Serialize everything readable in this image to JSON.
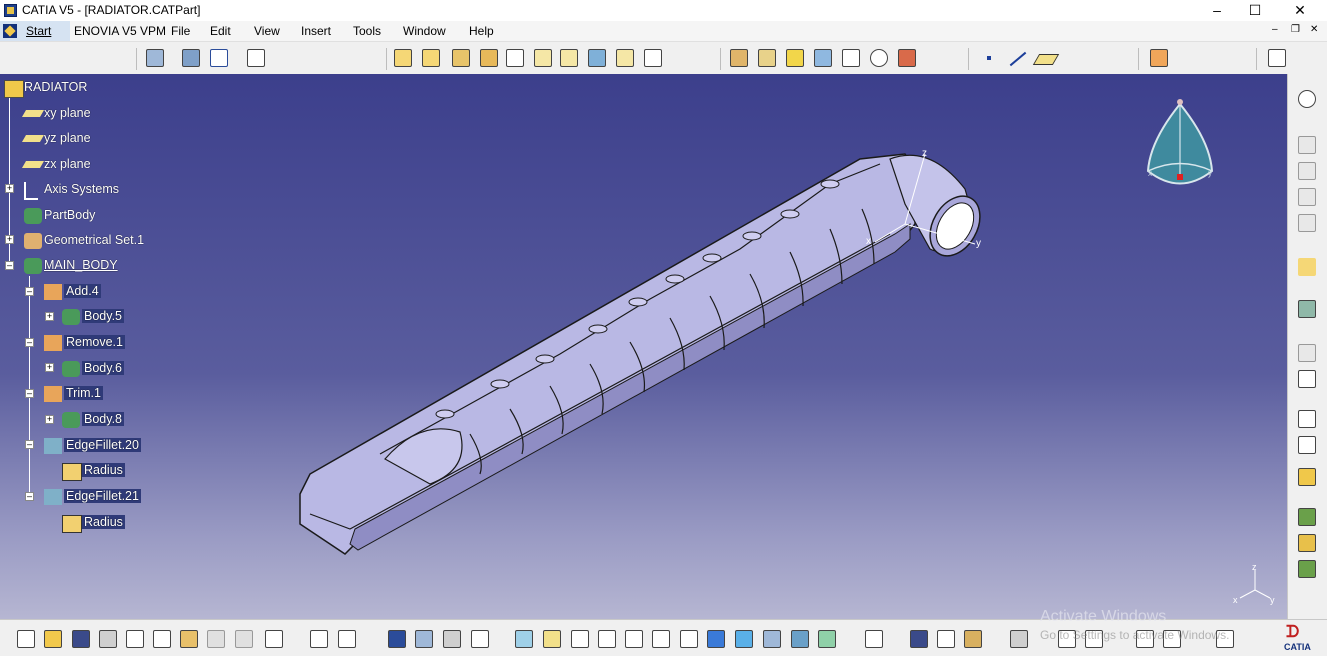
{
  "window": {
    "title": "CATIA V5 - [RADIATOR.CATPart]",
    "controls": [
      "–",
      "☐",
      "✕"
    ]
  },
  "menu": {
    "start": "Start",
    "items": [
      "ENOVIA V5 VPM",
      "File",
      "Edit",
      "View",
      "Insert",
      "Tools",
      "Window",
      "Help"
    ]
  },
  "tree": {
    "root": "RADIATOR",
    "nodes": [
      {
        "label": "xy plane",
        "icon": "plane-icon"
      },
      {
        "label": "yz plane",
        "icon": "plane-icon"
      },
      {
        "label": "zx plane",
        "icon": "plane-icon"
      },
      {
        "label": "Axis Systems",
        "icon": "axis-system-icon"
      },
      {
        "label": "PartBody",
        "icon": "body-gear-icon"
      },
      {
        "label": "Geometrical Set.1",
        "icon": "geometrical-set-icon"
      },
      {
        "label": "MAIN_BODY",
        "icon": "body-gear-icon"
      },
      {
        "label": "Add.4",
        "icon": "boolean-add-icon"
      },
      {
        "label": "Body.5",
        "icon": "body-gear-icon"
      },
      {
        "label": "Remove.1",
        "icon": "boolean-remove-icon"
      },
      {
        "label": "Body.6",
        "icon": "body-gear-icon"
      },
      {
        "label": "Trim.1",
        "icon": "boolean-trim-icon"
      },
      {
        "label": "Body.8",
        "icon": "body-gear-icon"
      },
      {
        "label": "EdgeFillet.20",
        "icon": "edge-fillet-icon"
      },
      {
        "label": "Radius",
        "icon": "radius-icon"
      },
      {
        "label": "EdgeFillet.21",
        "icon": "edge-fillet-icon"
      },
      {
        "label": "Radius",
        "icon": "radius-icon"
      }
    ]
  },
  "compass": {
    "axes": [
      "x",
      "y",
      "z"
    ]
  },
  "part_axes": {
    "x": "x",
    "y": "y",
    "z": "z"
  },
  "watermark": {
    "title": "Activate Windows",
    "subtitle": "Go to Settings to activate Windows."
  },
  "brand": {
    "logo_text": "CATIA"
  },
  "colors": {
    "viewport_top": "#3c3f8c",
    "viewport_bottom": "#b6b6d2",
    "part_fill": "#b9b8e4",
    "part_edge": "#1a1a1a"
  }
}
